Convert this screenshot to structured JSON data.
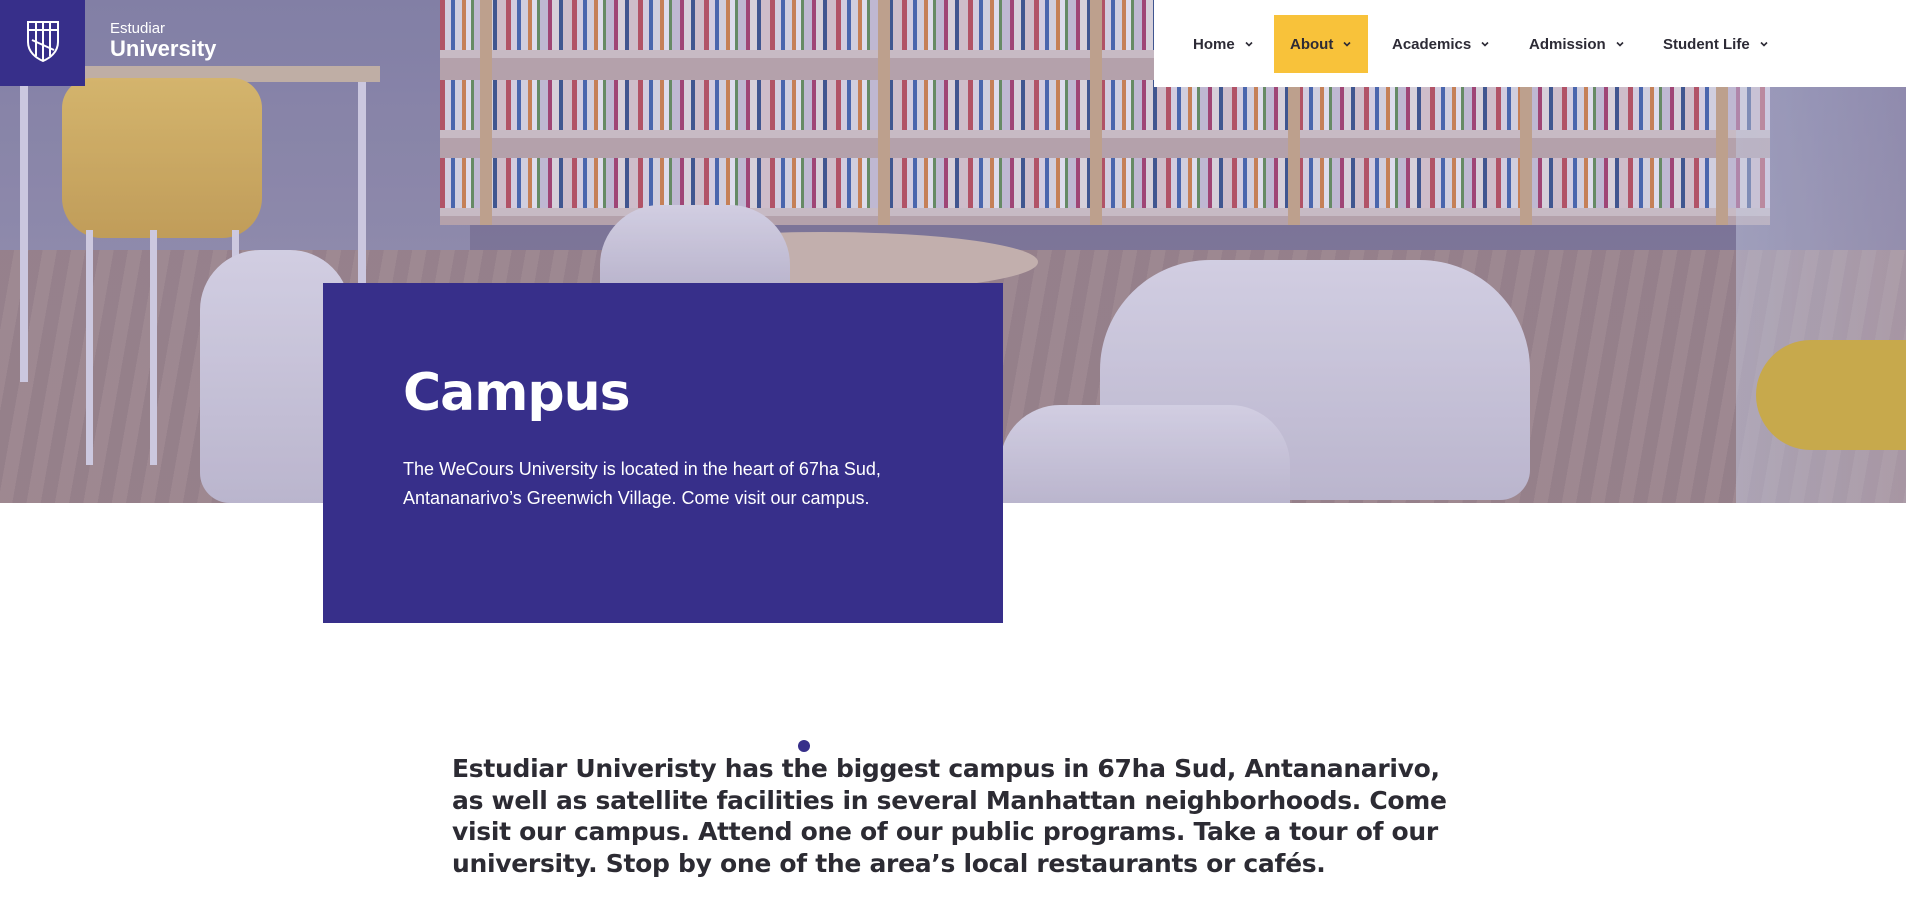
{
  "brand": {
    "line1": "Estudiar",
    "line2": "University",
    "logo_icon": "shield-icon"
  },
  "nav": {
    "items": [
      {
        "label": "Home",
        "icon": "chevron-down-icon"
      },
      {
        "label": "About",
        "icon": "chevron-down-icon",
        "active": true
      },
      {
        "label": "Academics",
        "icon": "chevron-down-icon"
      },
      {
        "label": "Admission",
        "icon": "chevron-down-icon"
      },
      {
        "label": "Student Life",
        "icon": "chevron-down-icon"
      }
    ]
  },
  "hero": {
    "title": "Campus",
    "description": "The WeCours University is located in the heart of 67ha Sud, Antananarivo’s Greenwich Village. Come visit our campus."
  },
  "body": {
    "intro": "Estudiar Univeristy has the biggest campus in 67ha Sud, Antananarivo, as well as satellite facilities in several Manhattan neighborhoods. Come visit our campus. Attend one of our public programs. Take a tour of our university. Stop by one of the area’s local restaurants or cafés."
  },
  "colors": {
    "primary": "#372f8a",
    "accent": "#f8c23a",
    "text": "#2c2b33"
  }
}
